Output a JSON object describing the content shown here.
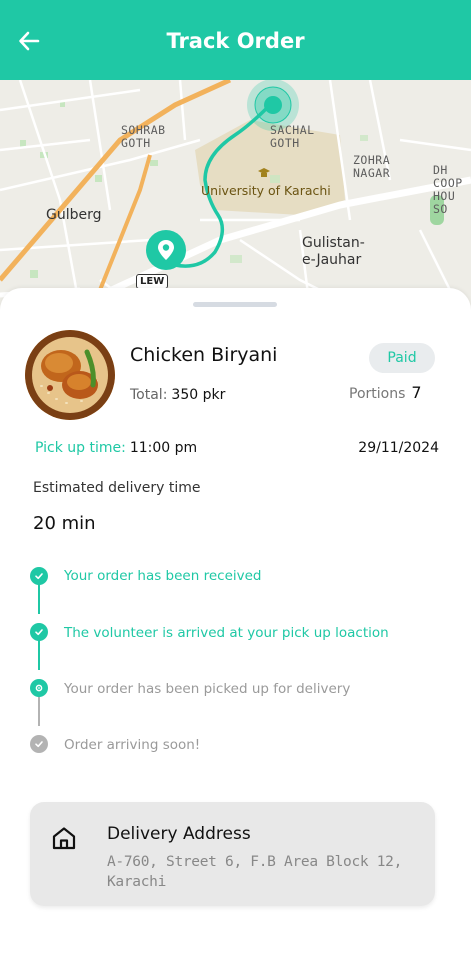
{
  "header": {
    "title": "Track Order",
    "back_icon": "arrow-left-icon"
  },
  "map": {
    "labels": {
      "sohrab_goth": "SOHRAB\nGOTH",
      "sachal_goth": "SACHAL\nGOTH",
      "zohra_nagar": "ZOHRA\nNAGAR",
      "dhoop": "DH\nCOOP\nHOU\nSO",
      "gulberg": "Gulberg",
      "gulistan": "Gulistan-\ne-Jauhar",
      "university": "University of Karachi",
      "road_shield": "LEW"
    },
    "route_color": "#1fc8a5"
  },
  "order": {
    "item_name": "Chicken Biryani",
    "total_label": "Total:",
    "total_value": "350 pkr",
    "status_badge": "Paid",
    "portions_label": "Portions",
    "portions_value": "7",
    "pickup_label": "Pick up time:",
    "pickup_value": "11:00 pm",
    "date": "29/11/2024",
    "estimated_label": "Estimated delivery time",
    "estimated_value": "20 min"
  },
  "timeline": [
    {
      "text": "Your order has been received",
      "state": "done"
    },
    {
      "text": "The volunteer is arrived at your pick up loaction",
      "state": "done"
    },
    {
      "text": "Your order has been picked up for delivery",
      "state": "current"
    },
    {
      "text": "Order arriving soon!",
      "state": "pending"
    }
  ],
  "address": {
    "title": "Delivery Address",
    "text": "A-760, Street 6, F.B Area Block 12, Karachi",
    "icon": "home-icon"
  },
  "colors": {
    "accent": "#1fc8a5",
    "muted": "#9a9a9a",
    "pending_dot": "#b3b3b3"
  }
}
